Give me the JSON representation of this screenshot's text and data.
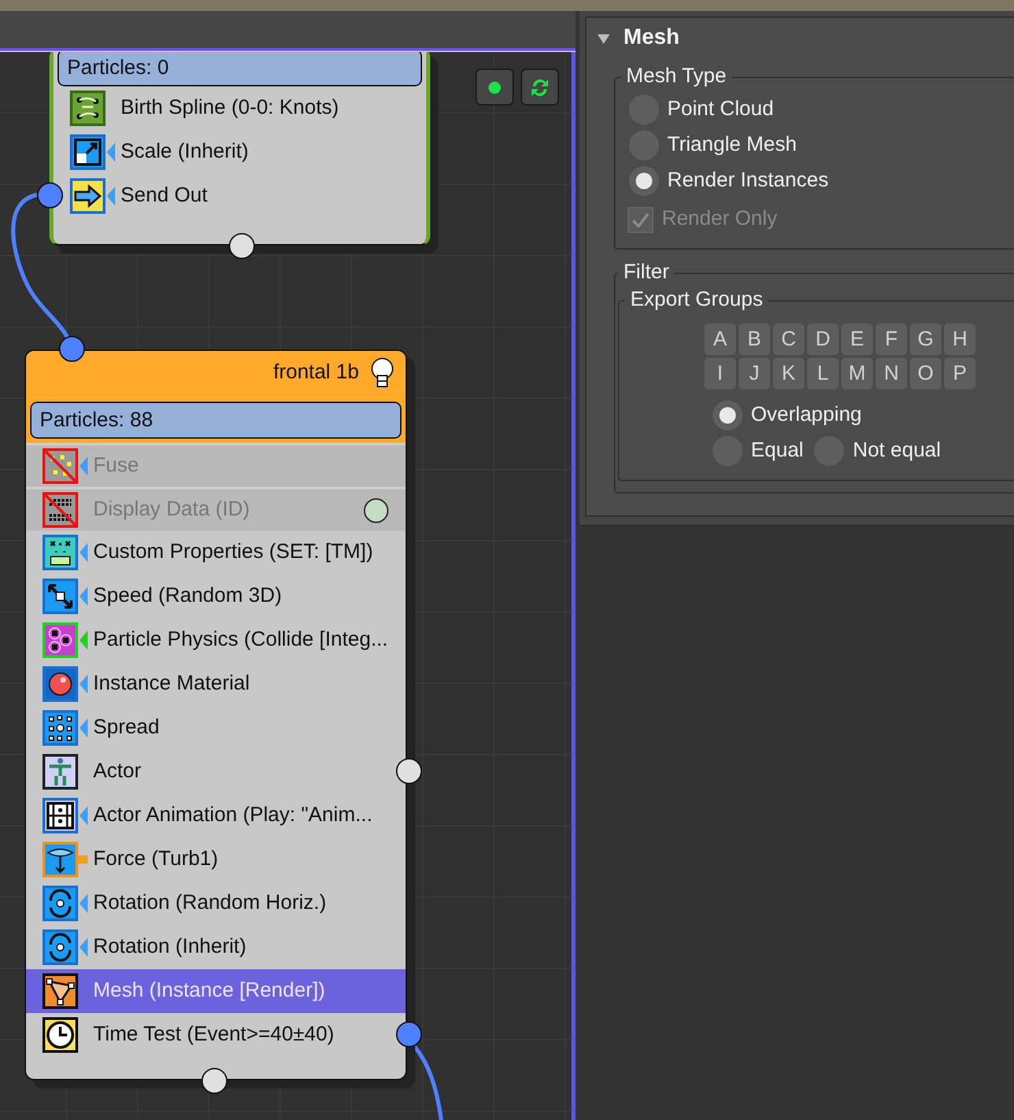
{
  "canvas": {
    "nodes": [
      {
        "particles": "Particles: 0",
        "operators": [
          {
            "kind": "birth",
            "label": "Birth Spline (0-0: Knots)",
            "disabled": false,
            "selected": false
          },
          {
            "kind": "scale",
            "label": "Scale (Inherit)",
            "disabled": false,
            "selected": false
          },
          {
            "kind": "send",
            "label": "Send Out",
            "disabled": false,
            "selected": false,
            "output": {
              "connected": true
            }
          }
        ]
      },
      {
        "title": "frontal 1b",
        "particles": "Particles: 88",
        "operators": [
          {
            "kind": "fuse",
            "label": "Fuse",
            "disabled": true,
            "selected": false
          },
          {
            "kind": "display",
            "label": "Display Data (ID)",
            "disabled": true,
            "selected": false
          },
          {
            "kind": "custom",
            "label": "Custom Properties (SET: [TM])",
            "disabled": false,
            "selected": false
          },
          {
            "kind": "speed",
            "label": "Speed (Random 3D)",
            "disabled": false,
            "selected": false
          },
          {
            "kind": "physics",
            "label": "Particle Physics (Collide [Integ...",
            "disabled": false,
            "selected": false
          },
          {
            "kind": "material",
            "label": "Instance Material",
            "disabled": false,
            "selected": false
          },
          {
            "kind": "spread",
            "label": "Spread",
            "disabled": false,
            "selected": false
          },
          {
            "kind": "actor",
            "label": "Actor",
            "disabled": false,
            "selected": false,
            "output": {
              "connected": false
            }
          },
          {
            "kind": "animation",
            "label": "Actor Animation (Play: \"Anim...",
            "disabled": false,
            "selected": false
          },
          {
            "kind": "force",
            "label": "Force (Turb1)",
            "disabled": false,
            "selected": false
          },
          {
            "kind": "rotation",
            "label": "Rotation (Random Horiz.)",
            "disabled": false,
            "selected": false
          },
          {
            "kind": "rotation",
            "label": "Rotation (Inherit)",
            "disabled": false,
            "selected": false
          },
          {
            "kind": "mesh",
            "label": "Mesh (Instance [Render])",
            "disabled": false,
            "selected": true
          },
          {
            "kind": "test",
            "label": "Time Test (Event>=40±40)",
            "disabled": false,
            "selected": false,
            "output": {
              "connected": true
            }
          }
        ]
      }
    ]
  },
  "panel": {
    "title": "Mesh",
    "expanded": true,
    "mesh_type": {
      "title": "Mesh Type",
      "options": [
        {
          "label": "Point Cloud",
          "selected": false
        },
        {
          "label": "Triangle Mesh",
          "selected": false
        },
        {
          "label": "Render Instances",
          "selected": true
        }
      ],
      "render_only": {
        "label": "Render Only",
        "checked": true,
        "disabled": true
      }
    },
    "filter": {
      "title": "Filter",
      "export_groups": {
        "title": "Export Groups",
        "letters": [
          "A",
          "B",
          "C",
          "D",
          "E",
          "F",
          "G",
          "H",
          "I",
          "J",
          "K",
          "L",
          "M",
          "N",
          "O",
          "P"
        ],
        "options": [
          {
            "label": "Overlapping",
            "selected": true
          },
          {
            "label": "Equal",
            "selected": false
          },
          {
            "label": "Not equal",
            "selected": false
          }
        ]
      }
    }
  }
}
